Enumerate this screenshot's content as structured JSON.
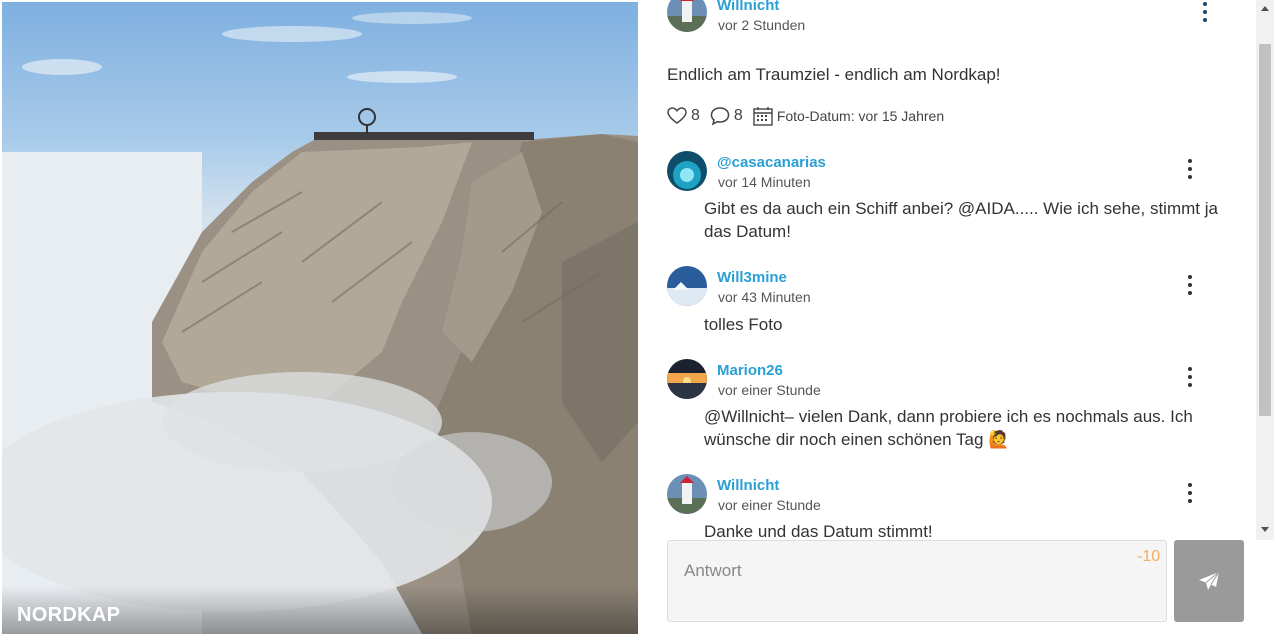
{
  "photo": {
    "title": "NORDKAP"
  },
  "post": {
    "author": "Willnicht",
    "time": "vor 2 Stunden",
    "text": "Endlich am Traumziel - endlich am Nordkap!",
    "likes": "8",
    "comments": "8",
    "photo_date": "Foto-Datum: vor 15 Jahren"
  },
  "comments": [
    {
      "author": "@casacanarias",
      "time": "vor 14 Minuten",
      "text": "Gibt es da auch ein Schiff anbei? @AIDA..... Wie ich sehe, stimmt ja das Datum!"
    },
    {
      "author": "Will3mine",
      "time": "vor 43 Minuten",
      "text": "tolles Foto"
    },
    {
      "author": "Marion26",
      "time": "vor einer Stunde",
      "text": "@Willnicht– vielen Dank, dann probiere ich es nochmals aus. Ich wünsche dir noch einen schönen Tag 🙋"
    },
    {
      "author": "Willnicht",
      "time": "vor einer Stunde",
      "text": "Danke und das Datum stimmt!"
    }
  ],
  "reply": {
    "placeholder": "Antwort",
    "counter": "-10"
  },
  "icons": {
    "heart": "heart-icon",
    "comment": "comment-icon",
    "calendar": "calendar-icon",
    "more": "more-vertical-icon",
    "send": "paper-plane-icon"
  },
  "colors": {
    "username": "#2a9fd6",
    "counter": "#f0b060",
    "send_button": "#9a9a9a"
  }
}
